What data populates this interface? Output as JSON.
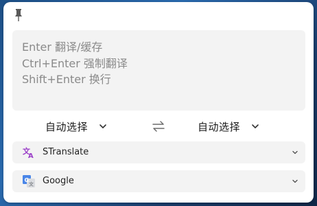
{
  "input": {
    "placeholder_lines": "Enter 翻译/缓存\nCtrl+Enter 强制翻译\nShift+Enter 换行"
  },
  "languages": {
    "source": "自动选择",
    "target": "自动选择"
  },
  "services": [
    {
      "name": "STranslate",
      "icon": "translate-icon"
    },
    {
      "name": "Google",
      "icon": "google-translate-icon"
    }
  ],
  "colors": {
    "panel_bg": "#ffffff",
    "field_bg": "#f3f3f3",
    "placeholder": "#8a8a8a",
    "stranslate_icon": "#9b3fc8",
    "google_icon": "#4a86e8"
  }
}
